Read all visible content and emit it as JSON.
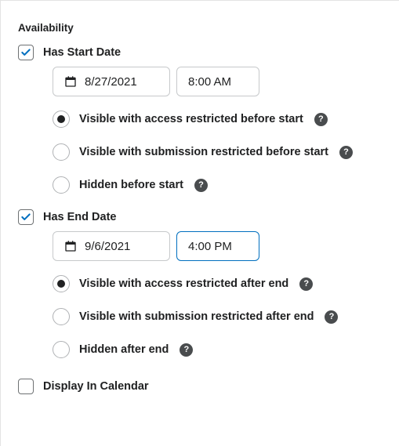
{
  "section_title": "Availability",
  "start": {
    "checkbox_label": "Has Start Date",
    "checked": true,
    "date_value": "8/27/2021",
    "time_value": "8:00 AM",
    "options": [
      {
        "label": "Visible with access restricted before start",
        "selected": true
      },
      {
        "label": "Visible with submission restricted before start",
        "selected": false
      },
      {
        "label": "Hidden before start",
        "selected": false
      }
    ]
  },
  "end": {
    "checkbox_label": "Has End Date",
    "checked": true,
    "date_value": "9/6/2021",
    "time_value": "4:00 PM",
    "time_focused": true,
    "options": [
      {
        "label": "Visible with access restricted after end",
        "selected": true
      },
      {
        "label": "Visible with submission restricted after end",
        "selected": false
      },
      {
        "label": "Hidden after end",
        "selected": false
      }
    ]
  },
  "display_in_calendar": {
    "label": "Display In Calendar",
    "checked": false
  },
  "help_glyph": "?"
}
